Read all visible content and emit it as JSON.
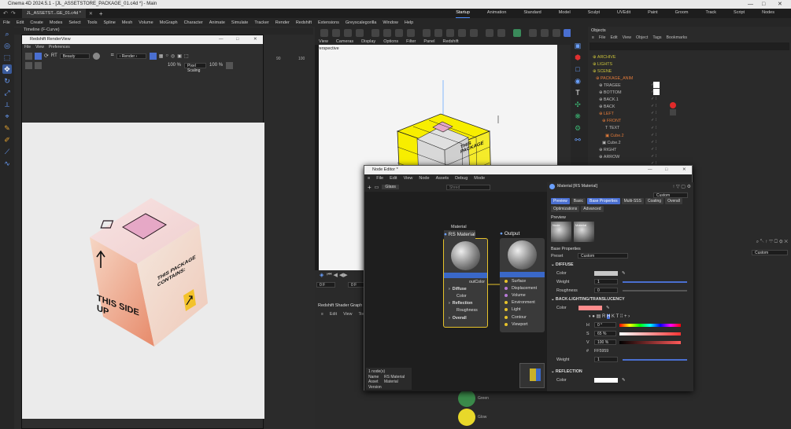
{
  "window": {
    "title": "Cinema 4D 2024.5.1 - [JL_ASSETSTORE_PACKAGE_01.c4d *] - Main"
  },
  "tabs": [
    "JL_ASSETST...GE_01.c4d *"
  ],
  "menu": [
    "File",
    "Edit",
    "Create",
    "Modes",
    "Select",
    "Tools",
    "Spline",
    "Mesh",
    "Volume",
    "MoGraph",
    "Character",
    "Animate",
    "Simulate",
    "Tracker",
    "Render",
    "Redshift",
    "Extensions",
    "Greyscalegorilla",
    "Window",
    "Help"
  ],
  "layouts": [
    "Startup",
    "Animation",
    "Standard",
    "Model",
    "Sculpt",
    "UVEdit",
    "Paint",
    "Groom",
    "Track",
    "Script",
    "Nodes"
  ],
  "timeline": {
    "title": "Timeline (F-Curve)"
  },
  "renderview": {
    "title": "Redshift RenderView",
    "menu": [
      "File",
      "View",
      "Preferences"
    ],
    "beauty": "Beauty",
    "zoom": "100 %",
    "scaling": "Pixel Scaling",
    "zoom2": "100 %"
  },
  "cube": {
    "side_text": "THIS SIDE UP",
    "front_text": "THIS PACKAGE CONTAINS:"
  },
  "viewport": {
    "menu": [
      "View",
      "Cameras",
      "Display",
      "Options",
      "Filter",
      "Panel",
      "Redshift"
    ],
    "label": "Perspective",
    "cube_text": "THIS PACKAGE"
  },
  "ruler": [
    "90",
    "100"
  ],
  "objects": {
    "title": "Objects",
    "menu": [
      "File",
      "Edit",
      "View",
      "Object",
      "Tags",
      "Bookmarks"
    ],
    "items": [
      "ARCHIVE",
      "LIGHTS",
      "SCENE",
      "PACKAGE_ANIM",
      "TRAGEE",
      "BOTTOM",
      "BACK.1",
      "BACK",
      "LEFT",
      "FRONT",
      "TEXT",
      "Cube.2",
      "Cube.2",
      "RIGHT",
      "ARROW"
    ]
  },
  "shadergraph": {
    "title": "Redshift Shader Graph",
    "menu": [
      "Edit",
      "View",
      "Tools"
    ],
    "frame": "0 F",
    "frame2": "0 F"
  },
  "nodeeditor": {
    "title": "Node Editor *",
    "menu": [
      "File",
      "Edit",
      "View",
      "Node",
      "Assets",
      "Debug",
      "Mode"
    ],
    "tab": "Glass",
    "search": "Shred",
    "material_label": "Material",
    "material_title": "RS Material",
    "output_label": "Output",
    "output_title": "Output",
    "material_out": "outColor",
    "material_ports": [
      "Diffuse",
      "Color",
      "Reflection",
      "Roughness",
      "Overall"
    ],
    "output_ports": [
      "Surface",
      "Displacement",
      "Volume",
      "Environment",
      "Light",
      "Contour",
      "Viewport"
    ],
    "info": {
      "count": "1 node(s)",
      "name_label": "Name",
      "name": "RS Material",
      "asset_label": "Asset",
      "asset": "Material",
      "version_label": "Version"
    },
    "below_nodes": [
      "Green",
      "Glow"
    ]
  },
  "props": {
    "header": "Material [RS Material]",
    "mode": "Custom",
    "tabs": [
      "Preview",
      "Basic",
      "Base Properties",
      "Multi-SSS",
      "Coating",
      "Overall"
    ],
    "tabs2": [
      "Optimizations",
      "Advanced"
    ],
    "preview_label": "Preview",
    "preview_items": [
      "Node",
      "Material"
    ],
    "base_label": "Base Properties",
    "preset_label": "Preset",
    "preset_value": "Custom",
    "diffuse": "DIFFUSE",
    "color_label": "Color",
    "weight_label": "Weight",
    "weight_value": "1",
    "rough_label": "Roughness",
    "rough_value": "0",
    "backlight": "BACK-LIGHTING/TRANSLUCENCY",
    "bl_color_label": "Color",
    "h_label": "H",
    "h_value": "0 °",
    "s_label": "S",
    "s_value": "65 %",
    "v_label": "V",
    "v_value": "100 %",
    "hex_label": "#",
    "hex_value": "FF5959",
    "bl_weight_label": "Weight",
    "bl_weight_value": "1",
    "reflection": "REFLECTION",
    "refl_color_label": "Color",
    "refl_weight_label": "Weight",
    "refl_weight_value": "1"
  },
  "attr": {
    "mode": "Custom"
  },
  "colors": {
    "accent": "#4a6fd0",
    "salmon": "#ff8c8c",
    "yellow": "#f5e400",
    "bg": "#2b2b2b"
  }
}
